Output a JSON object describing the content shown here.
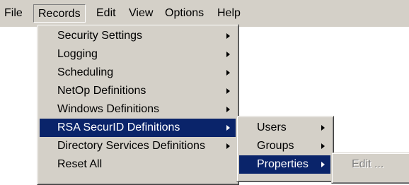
{
  "menubar": {
    "items": [
      {
        "label": "File"
      },
      {
        "label": "Records"
      },
      {
        "label": "Edit"
      },
      {
        "label": "View"
      },
      {
        "label": "Options"
      },
      {
        "label": "Help"
      }
    ]
  },
  "records_menu": {
    "items": [
      {
        "label": "Security Settings",
        "submenu": true
      },
      {
        "label": "Logging",
        "submenu": true
      },
      {
        "label": "Scheduling",
        "submenu": true
      },
      {
        "label": "NetOp Definitions",
        "submenu": true
      },
      {
        "label": "Windows Definitions",
        "submenu": true
      },
      {
        "label": "RSA SecurID Definitions",
        "submenu": true,
        "highlighted": true
      },
      {
        "label": "Directory Services Definitions",
        "submenu": true
      },
      {
        "label": "Reset All",
        "submenu": false
      }
    ]
  },
  "rsa_submenu": {
    "items": [
      {
        "label": "Users",
        "submenu": true
      },
      {
        "label": "Groups",
        "submenu": true
      },
      {
        "label": "Properties",
        "submenu": true,
        "highlighted": true
      }
    ]
  },
  "properties_submenu": {
    "items": [
      {
        "label": "Edit ...",
        "disabled": true
      }
    ]
  },
  "colors": {
    "menu_face": "#d4d0c8",
    "highlight": "#0a246a",
    "highlight_text": "#ffffff",
    "disabled_text": "#808080"
  }
}
